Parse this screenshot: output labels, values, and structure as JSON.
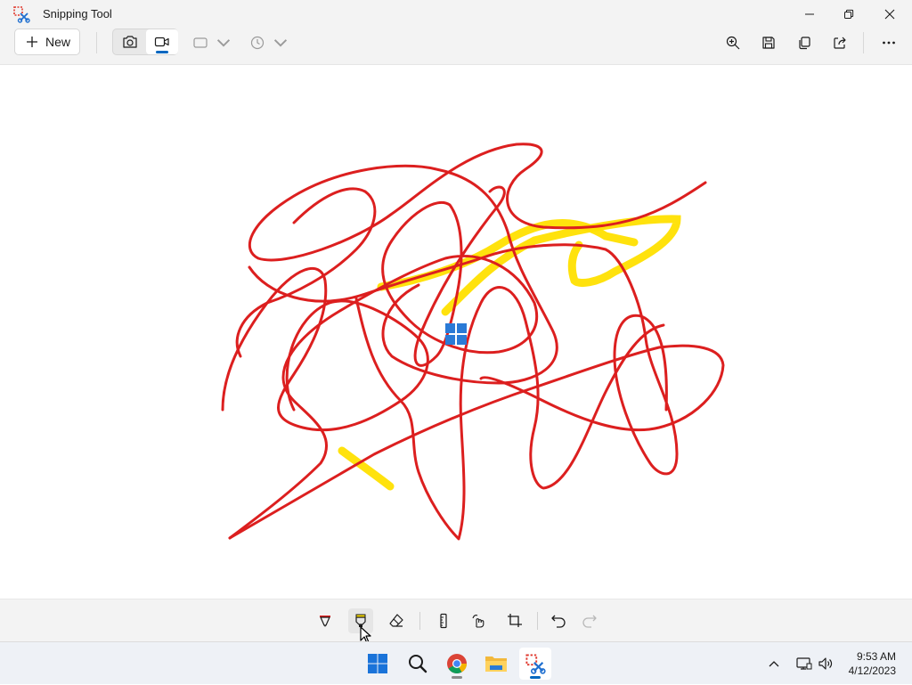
{
  "window": {
    "title": "Snipping Tool",
    "icons": {
      "app": "snipping-tool-icon",
      "minimize": "minimize-icon",
      "restore": "restore-icon",
      "close": "close-icon"
    }
  },
  "toolbar": {
    "new_label": "New",
    "modes": [
      {
        "name": "snip",
        "icon": "camera-icon",
        "active": false
      },
      {
        "name": "record",
        "icon": "video-icon",
        "active": true
      }
    ],
    "snip_shape_icon": "rectangle-icon",
    "delay_icon": "clock-icon",
    "right_icons": [
      "zoom-icon",
      "save-icon",
      "copy-icon",
      "share-icon",
      "more-icon"
    ]
  },
  "colors": {
    "accent": "#0067c0",
    "pen": "#e01e1e",
    "highlighter": "#ffe000",
    "chrome": "#f3f3f3"
  },
  "ink_toolbar": {
    "tools": [
      "ballpoint-pen-icon",
      "highlighter-icon",
      "eraser-icon",
      "ruler-icon",
      "touch-writing-icon",
      "crop-icon",
      "undo-icon",
      "redo-icon"
    ],
    "active_tool": "highlighter"
  },
  "taskbar": {
    "apps": [
      "windows-start-icon",
      "search-icon",
      "chrome-icon",
      "file-explorer-icon",
      "snipping-tool-icon"
    ],
    "tray_icons": [
      "chevron-up-icon",
      "network-icon",
      "volume-icon"
    ],
    "time": "9:53 AM",
    "date": "4/12/2023"
  }
}
